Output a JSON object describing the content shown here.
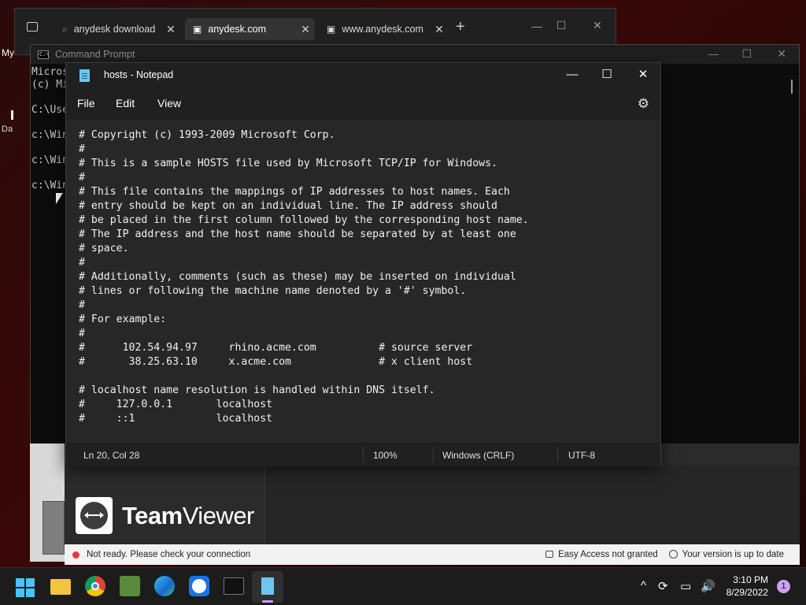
{
  "browser": {
    "tabs": [
      {
        "label": "anydesk download"
      },
      {
        "label": "anydesk.com"
      },
      {
        "label": "www.anydesk.com"
      }
    ],
    "new_tab": "+",
    "close": "✕"
  },
  "desktop": {
    "my_label": "My",
    "da_label": "Da"
  },
  "cmd": {
    "title": "Command Prompt",
    "lines": [
      "Micros",
      "(c) Mi",
      "C:\\Use",
      "c:\\Win",
      "c:\\Win",
      "c:\\Win"
    ]
  },
  "notepad": {
    "title": "hosts - Notepad",
    "menu": {
      "file": "File",
      "edit": "Edit",
      "view": "View"
    },
    "lines": [
      "# Copyright (c) 1993-2009 Microsoft Corp.",
      "#",
      "# This is a sample HOSTS file used by Microsoft TCP/IP for Windows.",
      "#",
      "# This file contains the mappings of IP addresses to host names. Each",
      "# entry should be kept on an individual line. The IP address should",
      "# be placed in the first column followed by the corresponding host name.",
      "# The IP address and the host name should be separated by at least one",
      "# space.",
      "#",
      "# Additionally, comments (such as these) may be inserted on individual",
      "# lines or following the machine name denoted by a '#' symbol.",
      "#",
      "# For example:",
      "#",
      "#      102.54.94.97     rhino.acme.com          # source server",
      "#       38.25.63.10     x.acme.com              # x client host",
      "",
      "# localhost name resolution is handled within DNS itself.",
      "#     127.0.0.1       localhost",
      "#     ::1             localhost"
    ],
    "status": {
      "position": "Ln 20, Col 28",
      "zoom": "100%",
      "line_ending": "Windows (CRLF)",
      "encoding": "UTF-8"
    }
  },
  "teamviewer": {
    "brand_bold": "Team",
    "brand_light": "Viewer",
    "status_text": "Not ready. Please check your connection",
    "easy_access": "Easy Access not granted",
    "version": "Your version is up to date"
  },
  "taskbar": {
    "time": "3:10 PM",
    "date": "8/29/2022",
    "notification_count": "1"
  },
  "colors": {
    "accent": "#0078d4",
    "status_red": "#e03b3b",
    "notepad_icon": "#6ec5f2"
  }
}
